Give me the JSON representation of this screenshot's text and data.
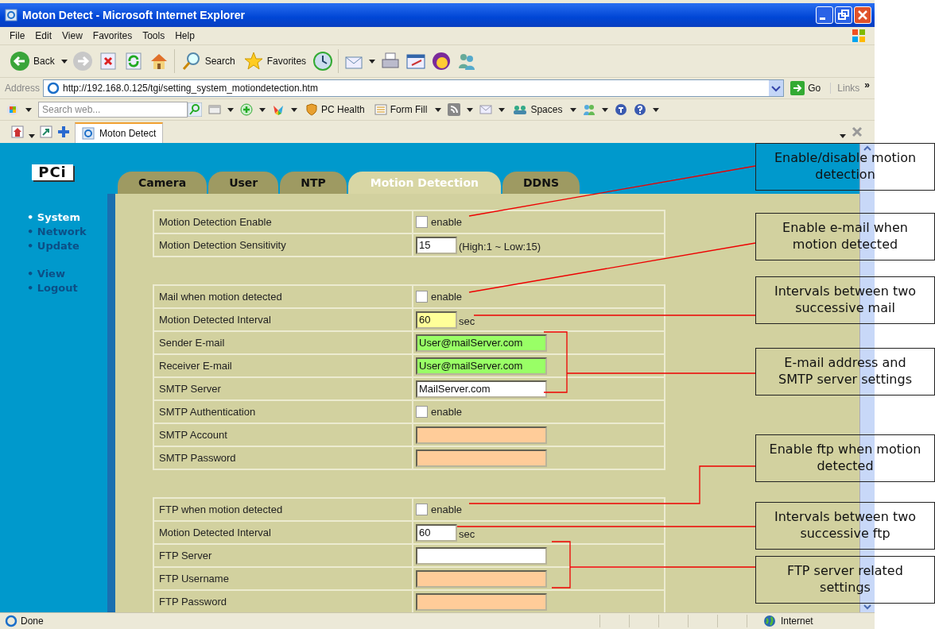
{
  "window": {
    "title": "Moton Detect - Microsoft Internet Explorer"
  },
  "menu": [
    "File",
    "Edit",
    "View",
    "Favorites",
    "Tools",
    "Help"
  ],
  "toolbar": {
    "back": "Back",
    "search": "Search",
    "favorites": "Favorites"
  },
  "address_bar": {
    "label": "Address",
    "url": "http://192.168.0.125/tgi/setting_system_motiondetection.htm",
    "go": "Go",
    "links": "Links",
    "more": "»"
  },
  "search_toolbar": {
    "placeholder": "Search web...",
    "pc_health": "PC Health",
    "form_fill": "Form Fill",
    "spaces": "Spaces"
  },
  "browser_tab": {
    "title": "Moton Detect"
  },
  "page": {
    "logo": "PCi",
    "nav_groups": [
      [
        {
          "label": "• System",
          "selected": true
        },
        {
          "label": "• Network",
          "selected": false
        },
        {
          "label": "• Update",
          "selected": false
        }
      ],
      [
        {
          "label": "• View",
          "selected": false
        },
        {
          "label": "• Logout",
          "selected": false
        }
      ]
    ],
    "tabs": [
      {
        "label": "Camera",
        "selected": false
      },
      {
        "label": "User",
        "selected": false
      },
      {
        "label": "NTP",
        "selected": false
      },
      {
        "label": "Motion Detection",
        "selected": true
      },
      {
        "label": "DDNS",
        "selected": false
      }
    ],
    "sections": [
      {
        "rows": [
          {
            "kind": "checkbox",
            "label": "Motion Detection Enable",
            "checked": false,
            "text": "enable"
          },
          {
            "kind": "field",
            "label": "Motion Detection Sensitivity",
            "value": "15",
            "color": "#ffffff",
            "suffix": "(High:1 ~ Low:15)"
          }
        ]
      },
      {
        "rows": [
          {
            "kind": "checkbox",
            "label": "Mail when motion detected",
            "checked": false,
            "text": "enable"
          },
          {
            "kind": "field",
            "label": "Motion Detected Interval",
            "value": "60",
            "color": "#ffff99",
            "suffix": "sec"
          },
          {
            "kind": "field",
            "label": "Sender E-mail",
            "value": "User@mailServer.com",
            "color": "#99ff66"
          },
          {
            "kind": "field",
            "label": "Receiver E-mail",
            "value": "User@mailServer.com",
            "color": "#99ff66"
          },
          {
            "kind": "field",
            "label": "SMTP Server",
            "value": "MailServer.com",
            "color": "#ffffff"
          },
          {
            "kind": "checkbox",
            "label": "SMTP Authentication",
            "checked": false,
            "text": "enable"
          },
          {
            "kind": "field",
            "label": "SMTP Account",
            "color": "#ffcc99"
          },
          {
            "kind": "field",
            "label": "SMTP Password",
            "color": "#ffcc99"
          }
        ]
      },
      {
        "rows": [
          {
            "kind": "checkbox",
            "label": "FTP when motion detected",
            "checked": false,
            "text": "enable"
          },
          {
            "kind": "field",
            "label": "Motion Detected Interval",
            "value": "60",
            "color": "#ffffff",
            "suffix": "sec"
          },
          {
            "kind": "field",
            "label": "FTP Server",
            "color": "#ffffff"
          },
          {
            "kind": "field",
            "label": "FTP Username",
            "color": "#ffcc99"
          },
          {
            "kind": "field",
            "label": "FTP Password",
            "color": "#ffcc99"
          }
        ]
      }
    ]
  },
  "status_bar": {
    "text": "Done",
    "zone": "Internet"
  },
  "callouts": [
    {
      "text": "Enable/disable motion detection"
    },
    {
      "text": "Enable e-mail when motion detected"
    },
    {
      "text": "Intervals between two successive mail"
    },
    {
      "text": "E-mail address and SMTP server settings"
    },
    {
      "text": "Enable ftp when motion detected"
    },
    {
      "text": "Intervals between two successive ftp"
    },
    {
      "text": "FTP server related settings"
    }
  ]
}
